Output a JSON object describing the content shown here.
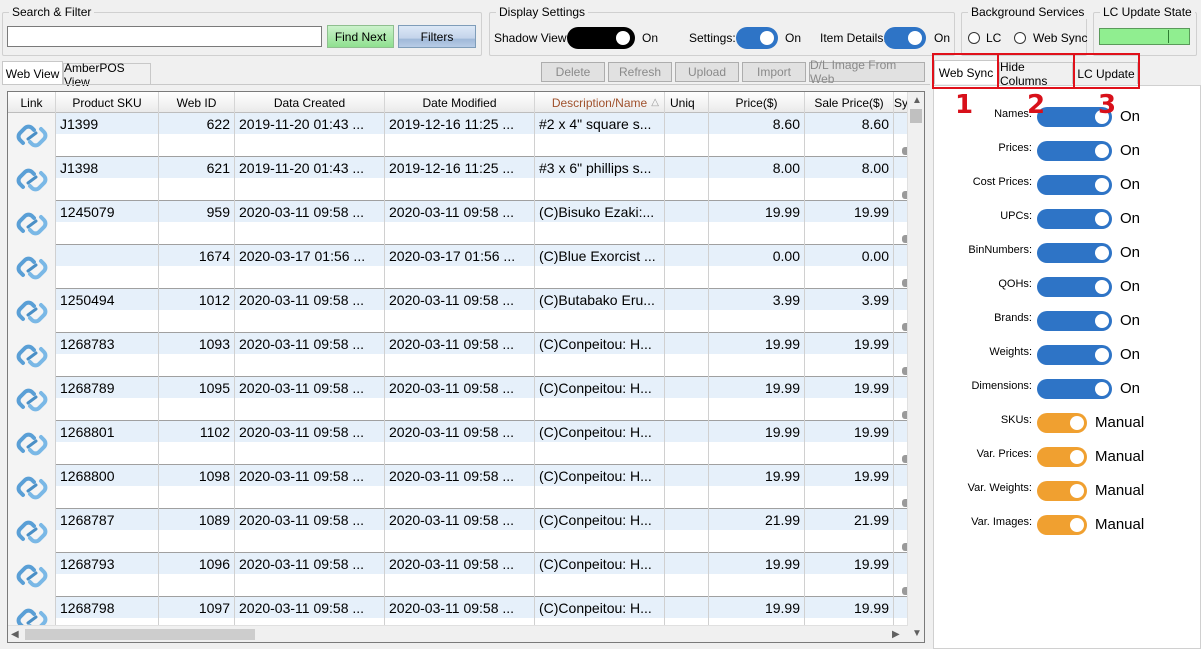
{
  "search_filter": {
    "title": "Search & Filter",
    "input_value": "",
    "find_next_label": "Find Next",
    "filters_label": "Filters"
  },
  "display_settings": {
    "title": "Display Settings",
    "shadow_view_label": "Shadow View:",
    "shadow_view_state": "On",
    "settings_label": "Settings:",
    "settings_state": "On",
    "item_details_label": "Item Details:",
    "item_details_state": "On"
  },
  "background_services": {
    "title": "Background Services",
    "lc_label": "LC",
    "web_sync_label": "Web Sync"
  },
  "lc_update_state": {
    "title": "LC Update State"
  },
  "left_tabs": [
    {
      "label": "Web View",
      "active": true
    },
    {
      "label": "AmberPOS View",
      "active": false
    }
  ],
  "toolbar": {
    "delete": "Delete",
    "refresh": "Refresh",
    "upload": "Upload",
    "import": "Import",
    "dl_image": "D/L Image From Web"
  },
  "grid": {
    "columns": [
      "Link",
      "Product SKU",
      "Web ID",
      "Data Created",
      "Date Modified",
      "Description/Name",
      "Uniq",
      "Price($)",
      "Sale Price($)",
      "Sy"
    ],
    "sorted_column": "Description/Name",
    "sort_glyph": "△",
    "rows": [
      {
        "sku": "J1399",
        "web_id": "622",
        "created": "2019-11-20 01:43 ...",
        "modified": "2019-12-16 11:25 ...",
        "desc": "#2 x 4\" square s...",
        "price": "8.60",
        "sale": "8.60"
      },
      {
        "sku": "J1398",
        "web_id": "621",
        "created": "2019-11-20 01:43 ...",
        "modified": "2019-12-16 11:25 ...",
        "desc": "#3 x 6\" phillips s...",
        "price": "8.00",
        "sale": "8.00"
      },
      {
        "sku": "1245079",
        "web_id": "959",
        "created": "2020-03-11 09:58 ...",
        "modified": "2020-03-11 09:58 ...",
        "desc": "(C)Bisuko Ezaki:...",
        "price": "19.99",
        "sale": "19.99"
      },
      {
        "sku": "",
        "web_id": "1674",
        "created": "2020-03-17 01:56 ...",
        "modified": "2020-03-17 01:56 ...",
        "desc": "(C)Blue Exorcist ...",
        "price": "0.00",
        "sale": "0.00"
      },
      {
        "sku": "1250494",
        "web_id": "1012",
        "created": "2020-03-11 09:58 ...",
        "modified": "2020-03-11 09:58 ...",
        "desc": "(C)Butabako Eru...",
        "price": "3.99",
        "sale": "3.99"
      },
      {
        "sku": "1268783",
        "web_id": "1093",
        "created": "2020-03-11 09:58 ...",
        "modified": "2020-03-11 09:58 ...",
        "desc": "(C)Conpeitou: H...",
        "price": "19.99",
        "sale": "19.99"
      },
      {
        "sku": "1268789",
        "web_id": "1095",
        "created": "2020-03-11 09:58 ...",
        "modified": "2020-03-11 09:58 ...",
        "desc": "(C)Conpeitou: H...",
        "price": "19.99",
        "sale": "19.99"
      },
      {
        "sku": "1268801",
        "web_id": "1102",
        "created": "2020-03-11 09:58 ...",
        "modified": "2020-03-11 09:58 ...",
        "desc": "(C)Conpeitou: H...",
        "price": "19.99",
        "sale": "19.99"
      },
      {
        "sku": "1268800",
        "web_id": "1098",
        "created": "2020-03-11 09:58 ...",
        "modified": "2020-03-11 09:58 ...",
        "desc": "(C)Conpeitou: H...",
        "price": "19.99",
        "sale": "19.99"
      },
      {
        "sku": "1268787",
        "web_id": "1089",
        "created": "2020-03-11 09:58 ...",
        "modified": "2020-03-11 09:58 ...",
        "desc": "(C)Conpeitou: H...",
        "price": "21.99",
        "sale": "21.99"
      },
      {
        "sku": "1268793",
        "web_id": "1096",
        "created": "2020-03-11 09:58 ...",
        "modified": "2020-03-11 09:58 ...",
        "desc": "(C)Conpeitou: H...",
        "price": "19.99",
        "sale": "19.99"
      },
      {
        "sku": "1268798",
        "web_id": "1097",
        "created": "2020-03-11 09:58 ...",
        "modified": "2020-03-11 09:58 ...",
        "desc": "(C)Conpeitou: H...",
        "price": "19.99",
        "sale": "19.99"
      }
    ]
  },
  "right_tabs": [
    {
      "label": "Web Sync",
      "number": "1"
    },
    {
      "label": "Hide Columns",
      "number": "2"
    },
    {
      "label": "LC Update",
      "number": "3"
    }
  ],
  "web_sync_settings": [
    {
      "label": "Names:",
      "state": "On",
      "color": "#2e74c6"
    },
    {
      "label": "Prices:",
      "state": "On",
      "color": "#2e74c6"
    },
    {
      "label": "Cost Prices:",
      "state": "On",
      "color": "#2e74c6"
    },
    {
      "label": "UPCs:",
      "state": "On",
      "color": "#2e74c6"
    },
    {
      "label": "BinNumbers:",
      "state": "On",
      "color": "#2e74c6"
    },
    {
      "label": "QOHs:",
      "state": "On",
      "color": "#2e74c6"
    },
    {
      "label": "Brands:",
      "state": "On",
      "color": "#2e74c6"
    },
    {
      "label": "Weights:",
      "state": "On",
      "color": "#2e74c6"
    },
    {
      "label": "Dimensions:",
      "state": "On",
      "color": "#2e74c6"
    },
    {
      "label": "SKUs:",
      "state": "Manual",
      "color": "#f0a030"
    },
    {
      "label": "Var. Prices:",
      "state": "Manual",
      "color": "#f0a030"
    },
    {
      "label": "Var. Weights:",
      "state": "Manual",
      "color": "#f0a030"
    },
    {
      "label": "Var. Images:",
      "state": "Manual",
      "color": "#f0a030"
    }
  ],
  "icons": {
    "link": "link-chain-icon",
    "scroll_up": "▲",
    "scroll_down": "▼",
    "scroll_left": "◀",
    "scroll_right": "▶"
  }
}
